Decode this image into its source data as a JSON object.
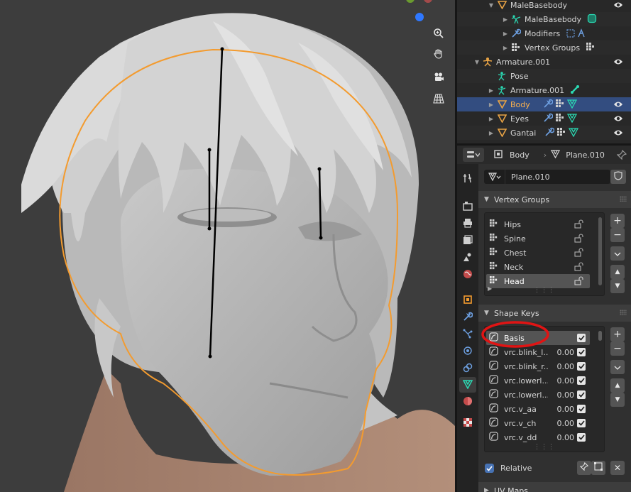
{
  "viewport": {
    "nav_buttons": [
      "zoom-icon",
      "hand-pan-icon",
      "camera-icon",
      "grid-perspective-icon"
    ]
  },
  "outliner": {
    "rows": [
      {
        "label": "MaleBasebody",
        "icon": "mesh-object-icon",
        "indent": 2,
        "expanded": true,
        "eye": true
      },
      {
        "label": "MaleBasebody",
        "icon": "armature-data-icon",
        "indent": 3,
        "expanded": false,
        "extras": [
          "mesh-data-icon"
        ]
      },
      {
        "label": "Modifiers",
        "icon": "wrench-icon",
        "indent": 3,
        "expanded": false,
        "extras": [
          "modifier-icons"
        ]
      },
      {
        "label": "Vertex Groups",
        "icon": "vertex-groups-icon",
        "indent": 3,
        "expanded": false,
        "extras": [
          "vertex-groups-icon"
        ]
      },
      {
        "label": "Armature.001",
        "icon": "armature-object-icon",
        "indent": 1,
        "expanded": true,
        "eye": true
      },
      {
        "label": "Pose",
        "icon": "pose-icon",
        "indent": 2,
        "expanded": null
      },
      {
        "label": "Armature.001",
        "icon": "armature-data-icon",
        "indent": 2,
        "expanded": false,
        "extras": [
          "bone-icon"
        ]
      },
      {
        "label": "Body",
        "icon": "mesh-object-icon",
        "indent": 2,
        "expanded": false,
        "selected": true,
        "eye": true,
        "extras": [
          "wrench-icon",
          "vertex-groups-icon",
          "mesh-data-icon"
        ]
      },
      {
        "label": "Eyes",
        "icon": "mesh-object-icon",
        "indent": 2,
        "expanded": false,
        "eye": true,
        "extras": [
          "wrench-icon",
          "vertex-groups-icon",
          "mesh-data-icon"
        ]
      },
      {
        "label": "Gantai",
        "icon": "mesh-object-icon",
        "indent": 2,
        "expanded": false,
        "eye": true,
        "extras": [
          "wrench-icon",
          "vertex-groups-icon",
          "mesh-data-icon"
        ]
      }
    ]
  },
  "properties": {
    "header": {
      "object": "Body",
      "data": "Plane.010"
    },
    "mesh_name": "Plane.010",
    "vertex_groups": {
      "title": "Vertex Groups",
      "items": [
        "Hips",
        "Spine",
        "Chest",
        "Neck",
        "Head"
      ],
      "selected": "Head"
    },
    "shape_keys": {
      "title": "Shape Keys",
      "items": [
        {
          "name": "Basis",
          "value": "",
          "checked": true,
          "selected": true
        },
        {
          "name": "vrc.blink_l...",
          "value": "0.00",
          "checked": true
        },
        {
          "name": "vrc.blink_r...",
          "value": "0.00",
          "checked": true
        },
        {
          "name": "vrc.lowerl...",
          "value": "0.00",
          "checked": true
        },
        {
          "name": "vrc.lowerl...",
          "value": "0.00",
          "checked": true
        },
        {
          "name": "vrc.v_aa",
          "value": "0.00",
          "checked": true
        },
        {
          "name": "vrc.v_ch",
          "value": "0.00",
          "checked": true
        },
        {
          "name": "vrc.v_dd",
          "value": "0.00",
          "checked": true
        }
      ]
    },
    "relative_label": "Relative",
    "relative_checked": true,
    "uv_maps_title": "UV Maps"
  },
  "colors": {
    "accent": "#4772b3",
    "selected_row": "#334d80",
    "annotation_circle": "#e01414",
    "object_outline": "#f39b2f",
    "mesh_icon": "#e8a345",
    "data_icon": "#2bd9b3"
  }
}
